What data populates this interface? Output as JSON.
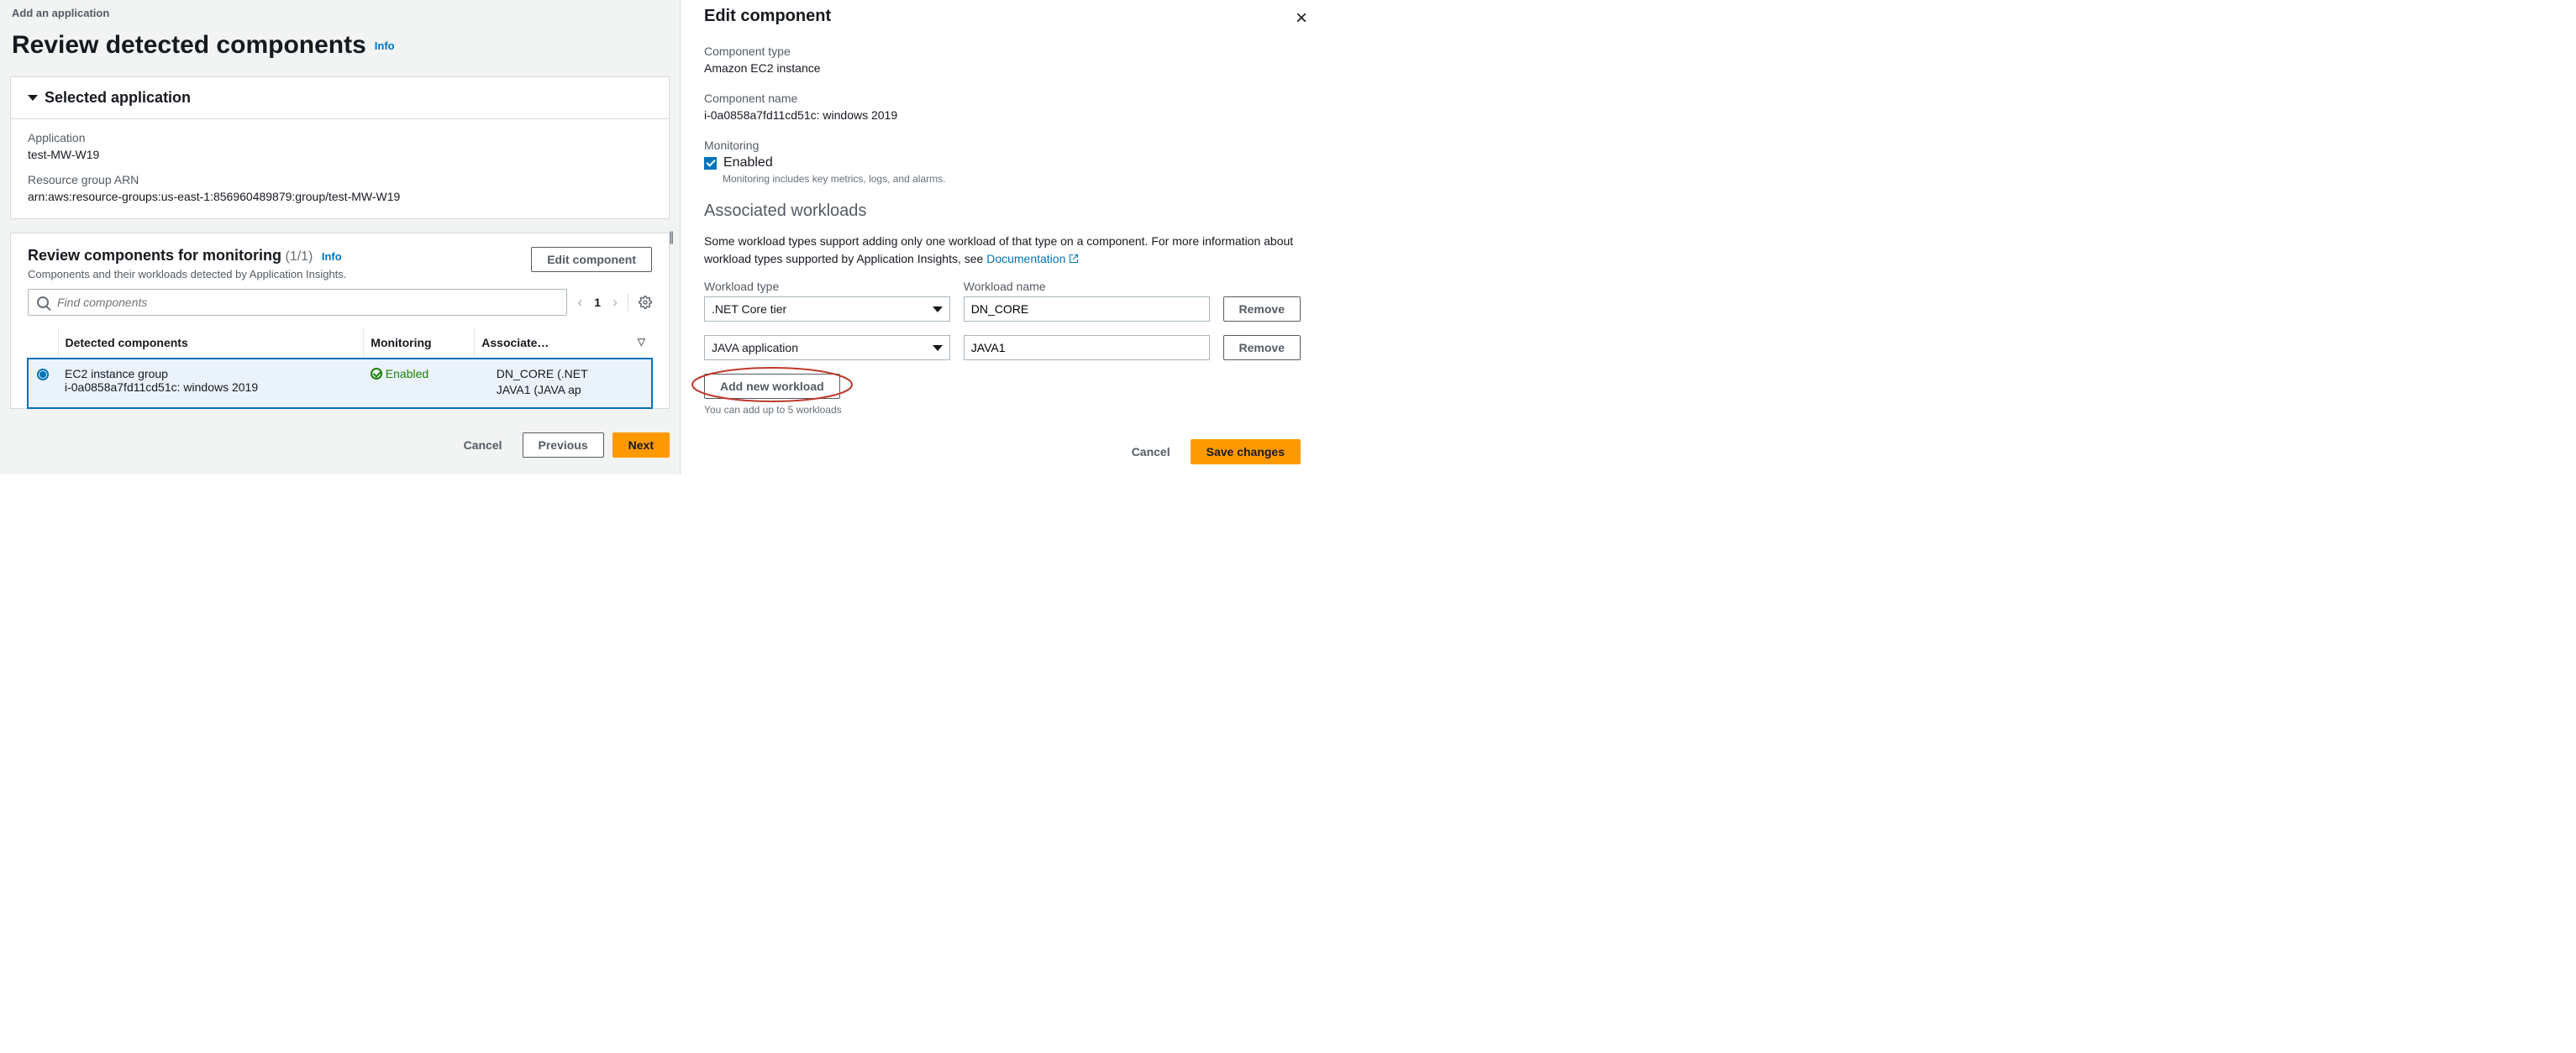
{
  "left": {
    "breadcrumb": "Add an application",
    "title": "Review detected components",
    "info": "Info",
    "app_card": {
      "title": "Selected application",
      "app_label": "Application",
      "app_value": "test-MW-W19",
      "arn_label": "Resource group ARN",
      "arn_value": "arn:aws:resource-groups:us-east-1:856960489879:group/test-MW-W19"
    },
    "review": {
      "title": "Review components for monitoring",
      "count": "(1/1)",
      "info": "Info",
      "desc": "Components and their workloads detected by Application Insights.",
      "edit_btn": "Edit component",
      "search_placeholder": "Find components",
      "page": "1",
      "cols": {
        "c1": "Detected components",
        "c2": "Monitoring",
        "c3": "Associate…"
      },
      "row": {
        "name": "EC2 instance group",
        "id": "i-0a0858a7fd11cd51c: windows 2019",
        "status": "Enabled",
        "wl0": "DN_CORE (.NET",
        "wl1": "JAVA1 (JAVA ap"
      }
    },
    "wizard": {
      "cancel": "Cancel",
      "previous": "Previous",
      "next": "Next"
    }
  },
  "right": {
    "title": "Edit component",
    "ctype_label": "Component type",
    "ctype_value": "Amazon EC2 instance",
    "cname_label": "Component name",
    "cname_value": "i-0a0858a7fd11cd51c: windows 2019",
    "mon_label": "Monitoring",
    "mon_enabled": "Enabled",
    "mon_help": "Monitoring includes key metrics, logs, and alarms.",
    "assoc_title": "Associated workloads",
    "assoc_desc_a": "Some workload types support adding only one workload of that type on a component. For more information about workload types supported by Application Insights, see ",
    "assoc_doc": "Documentation",
    "wl_type_label": "Workload type",
    "wl_name_label": "Workload name",
    "wl0_type": ".NET Core tier",
    "wl0_name": "DN_CORE",
    "wl1_type": "JAVA application",
    "wl1_name": "JAVA1",
    "remove": "Remove",
    "add_btn": "Add new workload",
    "limit_hint": "You can add up to 5 workloads",
    "cancel": "Cancel",
    "save": "Save changes"
  }
}
